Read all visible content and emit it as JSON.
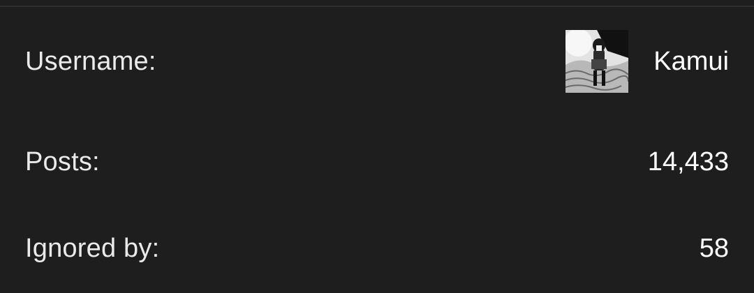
{
  "profile": {
    "username_label": "Username:",
    "username_value": "Kamui",
    "posts_label": "Posts:",
    "posts_value": "14,433",
    "ignored_label": "Ignored by:",
    "ignored_value": "58"
  }
}
